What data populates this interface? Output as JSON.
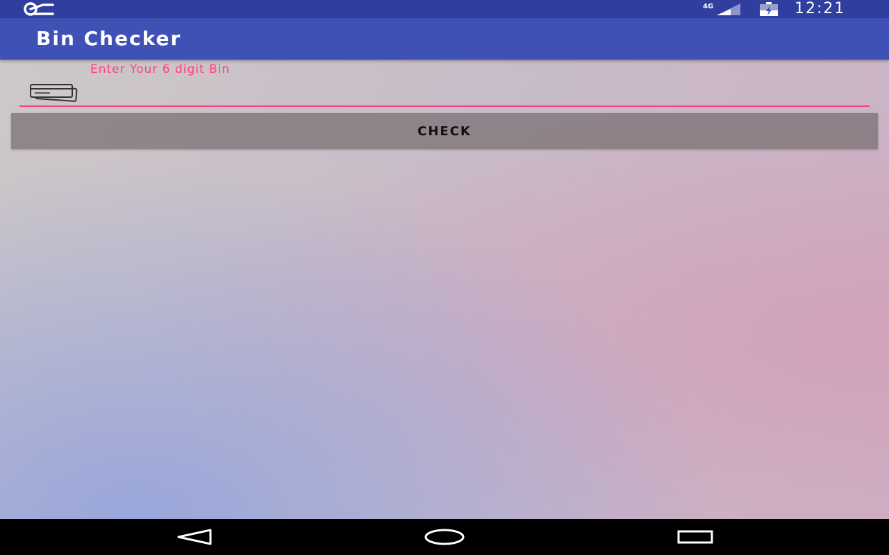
{
  "status_bar": {
    "network": "4G",
    "time": "12:21",
    "icons": [
      "notification-icon",
      "signal-icon",
      "battery-icon"
    ]
  },
  "app_bar": {
    "title": "Bin Checker"
  },
  "form": {
    "bin_label": "Enter Your 6 digit Bin",
    "bin_value": "",
    "check_label": "CHECK"
  },
  "nav_bar": {
    "icons": [
      "back-icon",
      "home-icon",
      "recents-icon"
    ]
  },
  "colors": {
    "status_bar": "#303f9f",
    "app_bar": "#3f51b5",
    "accent": "#ff4081",
    "nav_bar": "#000000"
  }
}
